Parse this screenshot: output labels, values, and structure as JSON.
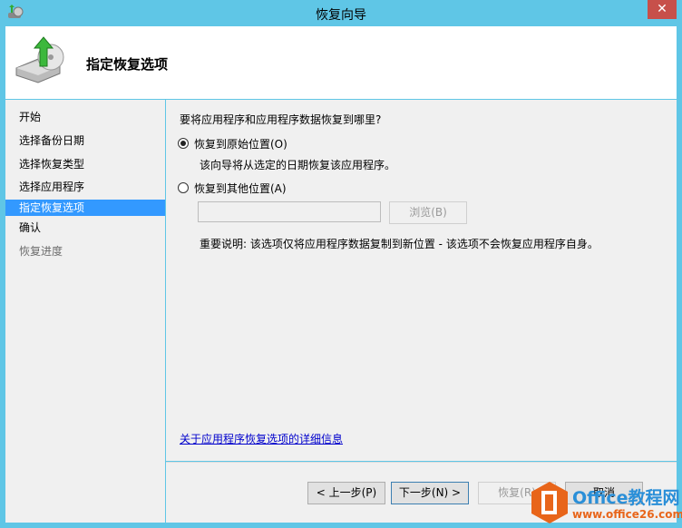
{
  "window": {
    "title": "恢复向导",
    "close": "✕"
  },
  "header": {
    "title": "指定恢复选项"
  },
  "sidebar": {
    "items": [
      {
        "label": "开始"
      },
      {
        "label": "选择备份日期"
      },
      {
        "label": "选择恢复类型"
      },
      {
        "label": "选择应用程序"
      },
      {
        "label": "指定恢复选项"
      },
      {
        "label": "确认"
      },
      {
        "label": "恢复进度"
      }
    ]
  },
  "main": {
    "question": "要将应用程序和应用程序数据恢复到哪里?",
    "option_original": "恢复到原始位置(O)",
    "option_original_desc": "该向导将从选定的日期恢复该应用程序。",
    "option_other": "恢复到其他位置(A)",
    "path_value": "",
    "browse": "浏览(B)",
    "note": "重要说明: 该选项仅将应用程序数据复制到新位置 - 该选项不会恢复应用程序自身。",
    "link": "关于应用程序恢复选项的详细信息"
  },
  "buttons": {
    "prev": "< 上一步(P)",
    "next": "下一步(N) >",
    "recover": "恢复(R)",
    "cancel": "取消"
  },
  "watermark": {
    "brand": "Office教程网",
    "url": "www.office26.com"
  }
}
